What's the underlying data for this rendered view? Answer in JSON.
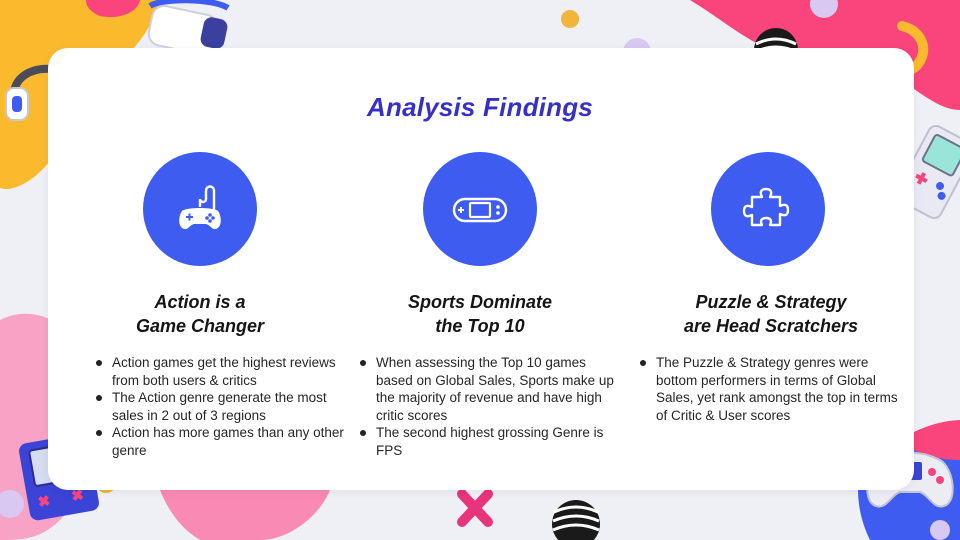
{
  "slide": {
    "title": "Analysis Findings"
  },
  "columns": [
    {
      "icon": "gamepad-controller-icon",
      "heading": "Action is a\nGame Changer",
      "bullets": [
        "Action games get the highest reviews from both users & critics",
        "The Action genre generate the most sales in 2 out of 3 regions",
        "Action has more games than any other genre"
      ]
    },
    {
      "icon": "handheld-console-icon",
      "heading": "Sports Dominate\nthe Top 10",
      "bullets": [
        "When assessing the Top 10 games based on Global Sales, Sports make up the majority of revenue and have high critic scores",
        "The second highest grossing Genre is FPS"
      ]
    },
    {
      "icon": "puzzle-piece-icon",
      "heading": "Puzzle & Strategy\nare Head Scratchers",
      "bullets": [
        "The Puzzle & Strategy genres were bottom performers in terms of Global Sales, yet rank amongst the top in terms of Critic & User scores"
      ]
    }
  ],
  "colors": {
    "accent_blue": "#3f5cf0",
    "title_blue": "#3730c6",
    "yellow": "#fbb92e",
    "pink": "#f9457c",
    "light_pink": "#f8a3c6",
    "lavender": "#d8c8f2",
    "card": "#ffffff",
    "background": "#eef0f5"
  }
}
